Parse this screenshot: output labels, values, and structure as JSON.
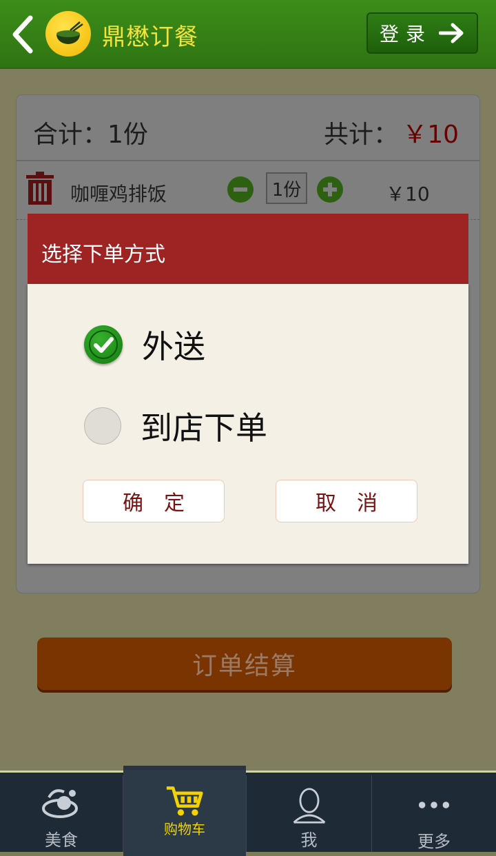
{
  "header": {
    "app_title": "鼎懋订餐",
    "login_label": "登录"
  },
  "cart": {
    "total_count_text": "合计：1份",
    "total_label": "共计：",
    "total_price": "￥10",
    "items": [
      {
        "name": "咖喱鸡排饭",
        "qty": "1份",
        "price": "￥10"
      }
    ],
    "checkout_label": "订单结算"
  },
  "dialog": {
    "title": "选择下单方式",
    "options": [
      {
        "label": "外送",
        "selected": true
      },
      {
        "label": "到店下单",
        "selected": false
      }
    ],
    "confirm_label": "确定",
    "cancel_label": "取消"
  },
  "tabbar": {
    "items": [
      {
        "label": "美食",
        "icon": "food-icon",
        "active": false
      },
      {
        "label": "购物车",
        "icon": "cart-icon",
        "active": true
      },
      {
        "label": "我",
        "icon": "user-icon",
        "active": false
      },
      {
        "label": "更多",
        "icon": "more-icon",
        "active": false
      }
    ]
  },
  "colors": {
    "header_green": "#3c8d1a",
    "title_yellow": "#f2e23a",
    "dialog_red": "#9e2424",
    "active_tab": "#f2d200"
  }
}
